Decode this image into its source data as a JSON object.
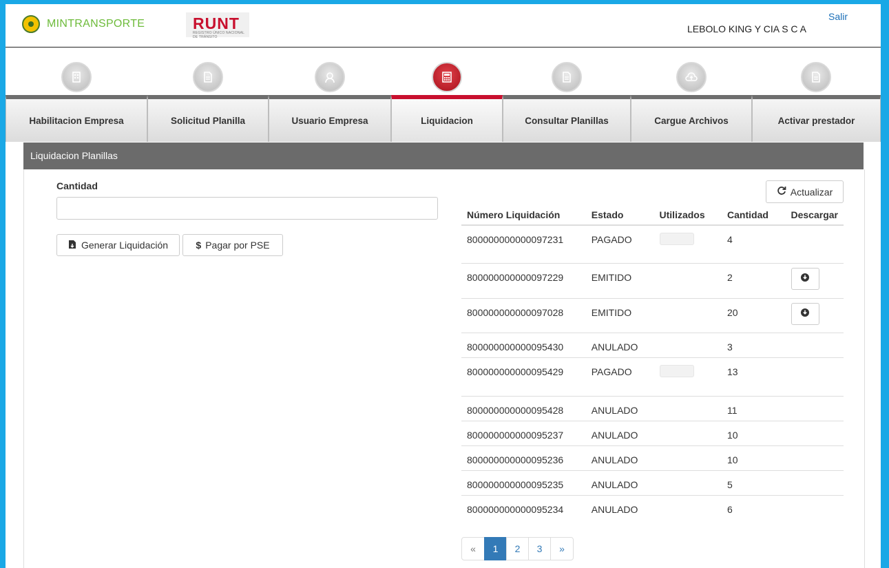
{
  "header": {
    "ministry_label": "MINTRANSPORTE",
    "runt_label": "RUNT",
    "runt_tagline": "REGISTRO ÚNICO NACIONAL DE TRÁNSITO",
    "logout_label": "Salir",
    "company_name": "LEBOLO KING Y CIA S C A"
  },
  "nav": {
    "items": [
      {
        "label": "Habilitacion Empresa",
        "icon": "building-icon"
      },
      {
        "label": "Solicitud Planilla",
        "icon": "document-icon"
      },
      {
        "label": "Usuario Empresa",
        "icon": "user-icon"
      },
      {
        "label": "Liquidacion",
        "icon": "calculator-icon",
        "active": true
      },
      {
        "label": "Consultar Planillas",
        "icon": "document-icon"
      },
      {
        "label": "Cargue Archivos",
        "icon": "upload-cloud-icon"
      },
      {
        "label": "Activar prestador",
        "icon": "document-icon"
      }
    ]
  },
  "panel": {
    "title": "Liquidacion Planillas",
    "cantidad_label": "Cantidad",
    "cantidad_value": "",
    "generate_label": "Generar Liquidación",
    "pay_label": "Pagar por PSE",
    "refresh_label": "Actualizar"
  },
  "table": {
    "headers": {
      "numero": "Número Liquidación",
      "estado": "Estado",
      "utilizados": "Utilizados",
      "cantidad": "Cantidad",
      "descargar": "Descargar"
    },
    "rows": [
      {
        "numero": "800000000000097231",
        "estado": "PAGADO",
        "cantidad": "4",
        "download": false
      },
      {
        "numero": "800000000000097229",
        "estado": "EMITIDO",
        "cantidad": "2",
        "download": true
      },
      {
        "numero": "800000000000097028",
        "estado": "EMITIDO",
        "cantidad": "20",
        "download": true
      },
      {
        "numero": "800000000000095430",
        "estado": "ANULADO",
        "cantidad": "3",
        "download": false
      },
      {
        "numero": "800000000000095429",
        "estado": "PAGADO",
        "cantidad": "13",
        "download": false
      },
      {
        "numero": "800000000000095428",
        "estado": "ANULADO",
        "cantidad": "11",
        "download": false
      },
      {
        "numero": "800000000000095237",
        "estado": "ANULADO",
        "cantidad": "10",
        "download": false
      },
      {
        "numero": "800000000000095236",
        "estado": "ANULADO",
        "cantidad": "10",
        "download": false
      },
      {
        "numero": "800000000000095235",
        "estado": "ANULADO",
        "cantidad": "5",
        "download": false
      },
      {
        "numero": "800000000000095234",
        "estado": "ANULADO",
        "cantidad": "6",
        "download": false
      }
    ]
  },
  "pagination": {
    "prev": "«",
    "pages": [
      "1",
      "2",
      "3"
    ],
    "active_page": "1",
    "next": "»"
  },
  "colors": {
    "frame": "#1aa8e6",
    "active_tab": "#c8102e",
    "panel_header": "#6b6b6b",
    "link": "#337ab7"
  }
}
